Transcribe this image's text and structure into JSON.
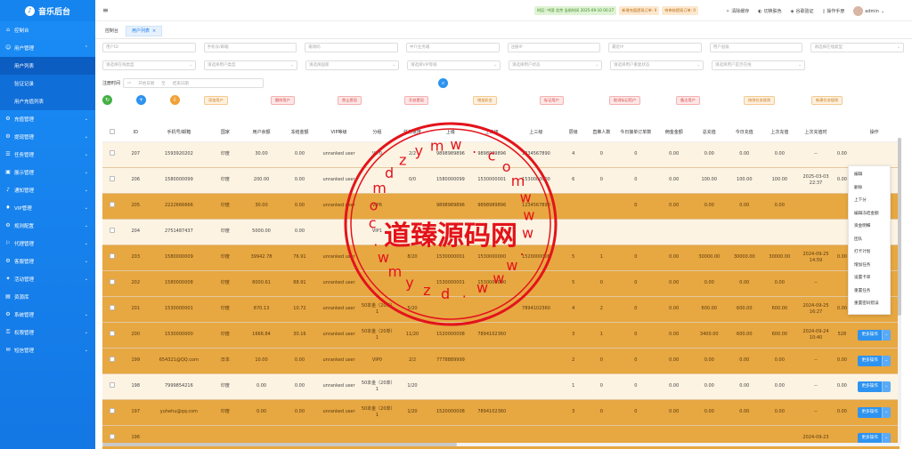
{
  "app": {
    "title": "音乐后台"
  },
  "sidebar": {
    "items": [
      {
        "label": "控制台",
        "icon": "home-icon",
        "has_arrow": false
      },
      {
        "label": "用户管理",
        "icon": "user-icon",
        "has_arrow": true,
        "expanded": true,
        "children": [
          {
            "label": "用户列表",
            "active": true
          },
          {
            "label": "验证记录",
            "active": false
          },
          {
            "label": "用户充值列表",
            "active": false
          }
        ]
      },
      {
        "label": "充值管理",
        "icon": "gear-icon",
        "has_arrow": true
      },
      {
        "label": "提现管理",
        "icon": "gear-icon",
        "has_arrow": true
      },
      {
        "label": "任务管理",
        "icon": "task-icon",
        "has_arrow": true
      },
      {
        "label": "展示管理",
        "icon": "display-icon",
        "has_arrow": true
      },
      {
        "label": "通知管理",
        "icon": "bell-icon",
        "has_arrow": true
      },
      {
        "label": "VIP管理",
        "icon": "vip-icon",
        "has_arrow": true
      },
      {
        "label": "规则配置",
        "icon": "gear-icon",
        "has_arrow": true
      },
      {
        "label": "代理管理",
        "icon": "agent-icon",
        "has_arrow": true
      },
      {
        "label": "客服管理",
        "icon": "gear-icon",
        "has_arrow": true
      },
      {
        "label": "活动管理",
        "icon": "gift-icon",
        "has_arrow": true
      },
      {
        "label": "资源库",
        "icon": "folder-icon",
        "has_arrow": false
      },
      {
        "label": "系统管理",
        "icon": "gear-icon",
        "has_arrow": true
      },
      {
        "label": "权限管理",
        "icon": "lock-icon",
        "has_arrow": true
      },
      {
        "label": "短信管理",
        "icon": "message-icon",
        "has_arrow": true
      }
    ]
  },
  "topbar": {
    "notices": [
      {
        "text": "时区: 中国 北京 当前时间 2025-09-10 00:27",
        "tone": "g"
      },
      {
        "text": "新增充值提现订单: 0",
        "tone": "o"
      },
      {
        "text": "待审核提现订单: 0",
        "tone": "o"
      }
    ],
    "tools": [
      {
        "label": "清除缓存",
        "icon": "broom-icon"
      },
      {
        "label": "切换肤色",
        "icon": "palette-icon"
      },
      {
        "label": "谷歌验证",
        "icon": "shield-icon"
      },
      {
        "label": "操作手册",
        "icon": "book-icon"
      }
    ],
    "user": "admin"
  },
  "tabs": [
    {
      "label": "控制台",
      "active": false,
      "closable": false
    },
    {
      "label": "用户列表",
      "active": true,
      "closable": true
    }
  ],
  "filters": {
    "row1": [
      "用户ID",
      "手机号/邮箱",
      "邀请码",
      "中介业务邀",
      "注册IP",
      "最近IP",
      "用户层级",
      "请选择在线类型"
    ],
    "row2": [
      "请选择在线类型",
      "请选择用户类型",
      "请选择国家",
      "请选择VIP等级",
      "请选择用户状态",
      "请选择用户重复状态",
      "请选择用户是否在线"
    ],
    "row1_dropdowns": [
      false,
      false,
      false,
      false,
      false,
      false,
      false,
      true
    ],
    "row2_dropdowns": [
      true,
      true,
      true,
      true,
      true,
      true,
      true
    ],
    "date_label": "注册时间",
    "date_start": "开始日期",
    "date_sep": "至",
    "date_end": "结束日期"
  },
  "actions": {
    "circles": [
      {
        "icon": "refresh-icon",
        "color": "#45b044"
      },
      {
        "icon": "plus-icon",
        "color": "#2e93f0"
      },
      {
        "icon": "export-icon",
        "color": "#f0a23a"
      }
    ],
    "buttons": [
      {
        "label": "添加用户",
        "tone": "o"
      },
      {
        "label": "删除用户",
        "tone": "r"
      },
      {
        "label": "禁止提现",
        "tone": "r"
      },
      {
        "label": "开启提现",
        "tone": "r"
      },
      {
        "label": "增加彩金",
        "tone": "o"
      },
      {
        "label": "标记用户",
        "tone": "r"
      },
      {
        "label": "取消标记用户",
        "tone": "r"
      },
      {
        "label": "备注用户",
        "tone": "r"
      },
      {
        "label": "修改任务规则",
        "tone": "o"
      },
      {
        "label": "新建任务规则",
        "tone": "o"
      }
    ]
  },
  "table": {
    "headers": [
      "",
      "ID",
      "手机号/邮箱",
      "国家",
      "用户余额",
      "冻结金额",
      "VIP等级",
      "分组",
      "任务进度",
      "上级",
      "上二级",
      "上三级",
      "层级",
      "直推人数",
      "今日接单订单数",
      "佣金金额",
      "总充值",
      "今日充值",
      "上次充值",
      "上次充值时",
      "",
      "操作"
    ],
    "rows": [
      {
        "tone": "light",
        "cells": [
          "",
          "207",
          "1593920202",
          "印度",
          "30.00",
          "0.00",
          "unranked user",
          "VIP0",
          "2/2",
          "9898989896",
          "9898989896",
          "1234567890",
          "4",
          "0",
          "0",
          "0.00",
          "0.00",
          "0.00",
          "0.00",
          "--",
          "0.00",
          ""
        ]
      },
      {
        "tone": "light",
        "cells": [
          "",
          "206",
          "1580000099",
          "印度",
          "200.00",
          "0.00",
          "unranked user",
          "",
          "0/0",
          "1580000099",
          "1530000001",
          "1530000000",
          "6",
          "0",
          "0",
          "0.00",
          "100.00",
          "100.00",
          "100.00",
          "2025-03-03 22:37",
          "0.00",
          ""
        ]
      },
      {
        "tone": "dark",
        "cells": [
          "",
          "205",
          "2222666666",
          "印度",
          "30.00",
          "0.00",
          "unranked user",
          "VIP6",
          "",
          "9898989896",
          "9898989896",
          "1234567890",
          "",
          "",
          "0",
          "0.00",
          "0.00",
          "0.00",
          "0.00",
          "",
          "",
          ""
        ]
      },
      {
        "tone": "light",
        "cells": [
          "",
          "204",
          "2751487437",
          "印度",
          "5000.00",
          "0.00",
          "",
          "VIP1",
          "",
          "",
          "",
          "",
          "",
          "",
          "",
          "",
          "",
          "",
          "",
          "",
          "",
          ""
        ]
      },
      {
        "tone": "dark",
        "cells": [
          "",
          "203",
          "1580000009",
          "印度",
          "39942.78",
          "76.91",
          "unranked user",
          "",
          "8/20",
          "1530000001",
          "1530000000",
          "1520000008",
          "5",
          "1",
          "0",
          "0.00",
          "30000.00",
          "30000.00",
          "30000.00",
          "2024-09-25 14:59",
          "0.00",
          ""
        ]
      },
      {
        "tone": "dark",
        "cells": [
          "",
          "202",
          "1580000008",
          "印度",
          "8000.61",
          "88.91",
          "unranked user",
          "",
          "",
          "1530000001",
          "1530000000",
          "",
          "5",
          "0",
          "0",
          "0.00",
          "0.00",
          "0.00",
          "0.00",
          "--",
          "",
          ""
        ]
      },
      {
        "tone": "dark",
        "cells": [
          "",
          "201",
          "1530000001",
          "印度",
          "870.13",
          "10.72",
          "unranked user",
          "50本金（20单）1",
          "5/20",
          "",
          "",
          "7894102360",
          "4",
          "2",
          "0",
          "0.00",
          "600.00",
          "600.00",
          "600.00",
          "2024-09-25 16:27",
          "0.00",
          ""
        ]
      },
      {
        "tone": "dark",
        "cells": [
          "",
          "200",
          "1530000000",
          "印度",
          "1666.84",
          "30.16",
          "unranked user",
          "50本金（20单）1",
          "11/20",
          "1520000008",
          "7894102360",
          "",
          "3",
          "1",
          "0",
          "0.00",
          "3400.00",
          "600.00",
          "600.00",
          "2024-09-24 10:40",
          "528",
          "更多操作"
        ]
      },
      {
        "tone": "dark",
        "cells": [
          "",
          "199",
          "654321@QQ.com",
          "日本",
          "10.00",
          "0.00",
          "unranked user",
          "VIP0",
          "2/2",
          "7778889999",
          "",
          "",
          "2",
          "0",
          "0",
          "0.00",
          "0.00",
          "0.00",
          "0.00",
          "--",
          "0.00",
          "更多操作"
        ]
      },
      {
        "tone": "light",
        "cells": [
          "",
          "198",
          "7999854216",
          "印度",
          "0.00",
          "0.00",
          "unranked user",
          "50本金（20单）1",
          "1/20",
          "",
          "",
          "",
          "1",
          "0",
          "0",
          "0.00",
          "0.00",
          "0.00",
          "0.00",
          "--",
          "0.00",
          "更多操作"
        ]
      },
      {
        "tone": "dark",
        "cells": [
          "",
          "197",
          "yuhehu@qq.com",
          "印度",
          "0.00",
          "0.00",
          "unranked user",
          "50本金（20单）1",
          "1/20",
          "1520000008",
          "7894102360",
          "",
          "3",
          "0",
          "0",
          "0.00",
          "0.00",
          "0.00",
          "0.00",
          "--",
          "0.00",
          "更多操作"
        ]
      },
      {
        "tone": "dark",
        "cells": [
          "",
          "196",
          "",
          "",
          "",
          "",
          "",
          "",
          "",
          "",
          "",
          "",
          "",
          "",
          "",
          "",
          "",
          "",
          "",
          "2024-09-23",
          "",
          "更多操作"
        ]
      }
    ],
    "more_label": "更多操作"
  },
  "dropdown_menu": {
    "items": [
      "编辑",
      "删除",
      "上下分",
      "编辑冻结金额",
      "资金明细",
      "团队",
      "打卡计划",
      "增加任务",
      "设置卡单",
      "重置任务",
      "重置密码错误"
    ]
  },
  "watermark": {
    "center_text": "道臻源码网",
    "ring_chars": [
      "d",
      "z",
      "y",
      "m",
      "w",
      ".",
      "c",
      "o",
      "m",
      "w",
      "w",
      "w",
      ".",
      "w",
      "w",
      "w",
      ".",
      "d",
      "z",
      "y",
      "m",
      "w",
      ".",
      "c",
      "o",
      "m"
    ],
    "color": "#e3131b"
  },
  "colors": {
    "sidebar": "#1a8cf5",
    "row_dark": "#e7a741",
    "row_light": "#fdf3e2",
    "primary": "#2e93f0"
  }
}
